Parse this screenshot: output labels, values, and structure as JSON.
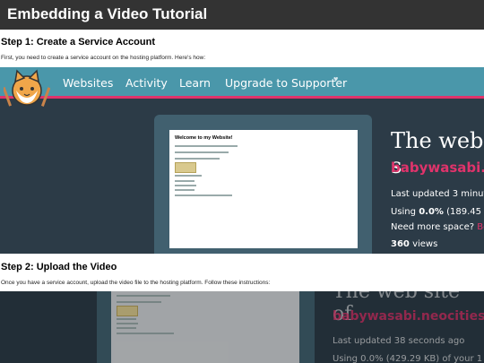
{
  "header": {
    "title": "Embedding a Video Tutorial"
  },
  "step1": {
    "heading": "Step 1: Create a Service Account",
    "text": "First, you need to create a service account on the hosting platform. Here's how:"
  },
  "step2": {
    "heading": "Step 2: Upload the Video",
    "text": "Once you have a service account, upload the video file to the hosting platform. Follow these instructions:"
  },
  "site": {
    "nav": [
      "Websites",
      "Activity",
      "Learn",
      "Upgrade to Supporter"
    ],
    "preview_heading": "Welcome to my Website!",
    "title": "The web s",
    "sitename": "babywasabi.n",
    "last_updated": "Last updated 3 minut",
    "using_prefix": "Using",
    "using_value": "0.0%",
    "using_rest": "(189.45",
    "need_space": "Need more space?",
    "need_space_link": "Be",
    "views_value": "360",
    "views_label": "views"
  },
  "site2": {
    "title": "The web site of",
    "sitename": "babywasabi.neocities.",
    "last_updated": "Last updated 38 seconds ago",
    "using": "Using 0.0% (429.29 KB) of your 1"
  },
  "colors": {
    "nav": "#4a97aa",
    "accent": "#e0336b",
    "bg": "#2c3b47"
  }
}
